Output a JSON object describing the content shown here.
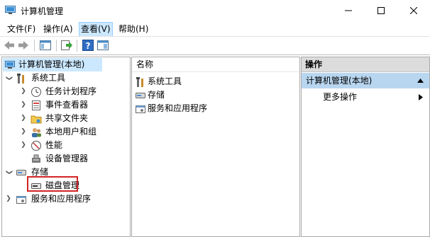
{
  "window": {
    "title": "计算机管理"
  },
  "menu": [
    "文件(F)",
    "操作(A)",
    "查看(V)",
    "帮助(H)"
  ],
  "tree": {
    "root": "计算机管理(本地)",
    "system_tools": "系统工具",
    "task_scheduler": "任务计划程序",
    "event_viewer": "事件查看器",
    "shared_folders": "共享文件夹",
    "local_users": "本地用户和组",
    "performance": "性能",
    "device_manager": "设备管理器",
    "storage": "存储",
    "disk_management": "磁盘管理",
    "services_apps": "服务和应用程序"
  },
  "list": {
    "header": "名称",
    "items": [
      "系统工具",
      "存储",
      "服务和应用程序"
    ]
  },
  "actions": {
    "header": "操作",
    "section": "计算机管理(本地)",
    "more": "更多操作"
  }
}
